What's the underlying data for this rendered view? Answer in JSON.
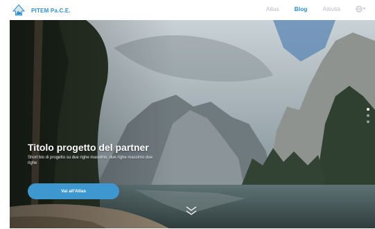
{
  "header": {
    "brand_name": "PITEM Pa.C.E.",
    "logo_icon": "mountain-house-logo-icon",
    "accent_color": "#2e8ec7",
    "nav": [
      {
        "label": "Atlas",
        "active": false
      },
      {
        "label": "Blog",
        "active": true
      },
      {
        "label": "Attività",
        "active": false
      }
    ],
    "language_icon": "globe-icon"
  },
  "hero": {
    "title": "Titolo progetto del partner",
    "description": "Short bio di progetto su due righe massimo, due righe massimo due righe",
    "cta_label": "Vai all'Atlas",
    "cta_color": "#3e97cf",
    "scroll_icon": "double-chevron-down-icon",
    "slides_total": 3,
    "slide_active": 1
  }
}
